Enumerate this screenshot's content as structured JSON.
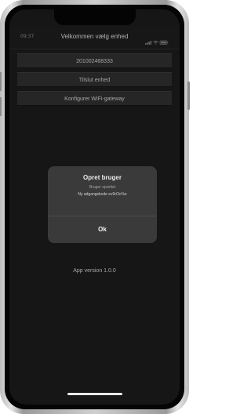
{
  "status_bar": {
    "time": "09:37",
    "icons": [
      "signal-icon",
      "wifi-icon",
      "battery-icon"
    ]
  },
  "nav": {
    "title": "Velkommen vælg enhed"
  },
  "menu": {
    "items": [
      {
        "label": "201002468333"
      },
      {
        "label": "Tilslut enhed"
      },
      {
        "label": "Konfigurer WiFi-gateway"
      }
    ]
  },
  "alert": {
    "title": "Opret bruger",
    "subtitle": "Bruger oprettet",
    "message": "Ny adgangskode ev9rOc%e",
    "ok_label": "Ok"
  },
  "footer": {
    "version": "App version 1.0.0"
  },
  "colors": {
    "screen_bg": "#1b1b1b",
    "button_bg": "#2f2f2f",
    "alert_bg": "#3a3a3a",
    "text_primary": "#ececec",
    "text_secondary": "#a6a6a6"
  }
}
